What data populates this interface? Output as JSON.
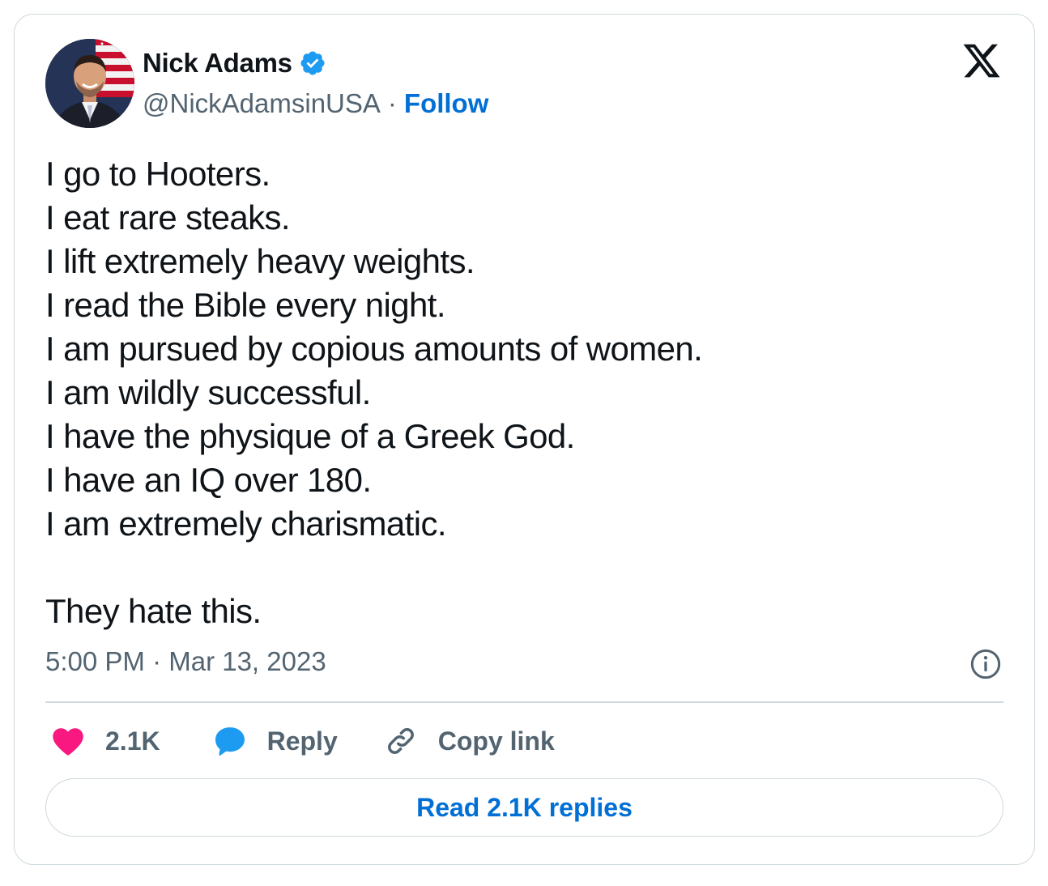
{
  "author": {
    "name": "Nick Adams",
    "handle": "@NickAdamsinUSA",
    "separator": "·",
    "follow_label": "Follow",
    "verified_color": "#1d9bf0"
  },
  "tweet": {
    "lines": [
      "I go to Hooters.",
      "I eat rare steaks.",
      "I lift extremely heavy weights.",
      "I read the Bible every night.",
      "I am pursued by copious amounts of women.",
      "I am wildly successful.",
      "I have the physique of a Greek God.",
      "I have an IQ over 180.",
      "I am extremely charismatic."
    ],
    "closing_line": "They hate this.",
    "timestamp": "5:00 PM · Mar 13, 2023"
  },
  "actions": {
    "like_count": "2.1K",
    "reply_label": "Reply",
    "copy_link_label": "Copy link",
    "read_replies_label": "Read 2.1K replies"
  },
  "icons": {
    "platform_logo": "x-logo-icon",
    "verified": "verified-badge-icon",
    "info": "info-icon",
    "like": "heart-icon",
    "reply": "speech-bubble-icon",
    "copy_link": "link-icon"
  },
  "colors": {
    "like": "#f91880",
    "reply": "#1d9bf0",
    "link": "#006fd6",
    "text": "#0f1419",
    "secondary": "#536471",
    "border": "#cfd9de"
  }
}
